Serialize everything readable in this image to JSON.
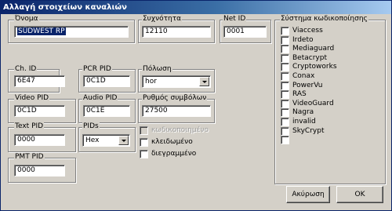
{
  "window": {
    "title": "Αλλαγή στοιχείων καναλιών"
  },
  "fields": {
    "name": {
      "label": "Όνομα",
      "value": "SÜDWEST RP"
    },
    "frequency": {
      "label": "Συχνότητα",
      "value": "12110"
    },
    "net_id": {
      "label": "Net ID",
      "value": "0001"
    },
    "ch_id": {
      "label": "Ch. ID",
      "value": "6E47"
    },
    "pcr_pid": {
      "label": "PCR PID",
      "value": "0C1D"
    },
    "polarization": {
      "label": "Πόλωση",
      "value": "hor"
    },
    "video_pid": {
      "label": "Video PID",
      "value": "0C1D"
    },
    "audio_pid": {
      "label": "Audio PID",
      "value": "0C1E"
    },
    "symbol_rate": {
      "label": "Ρυθμός συμβόλων",
      "value": "27500"
    },
    "text_pid": {
      "label": "Text PID",
      "value": "0000"
    },
    "pids": {
      "label": "PIDs",
      "value": "Hex"
    },
    "pmt_pid": {
      "label": "PMT PID",
      "value": "0000"
    }
  },
  "flags": [
    {
      "label": "κωδικοποιημένο",
      "checked": false,
      "disabled": true
    },
    {
      "label": "κλειδωμένο",
      "checked": false,
      "disabled": false
    },
    {
      "label": "διεγραμμένο",
      "checked": false,
      "disabled": false
    }
  ],
  "encryption": {
    "label": "Σύστημα κωδικοποίησης",
    "items": [
      "Viaccess",
      "Irdeto",
      "Mediaguard",
      "Betacrypt",
      "Cryptoworks",
      "Conax",
      "PowerVu",
      "RAS",
      "VideoGuard",
      "Nagra",
      "invalid",
      "SkyCrypt",
      ""
    ]
  },
  "buttons": {
    "cancel": "Ακύρωση",
    "ok": "OK"
  }
}
